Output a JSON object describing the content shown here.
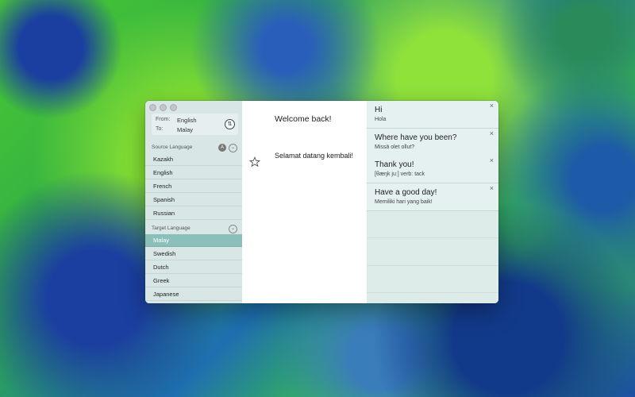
{
  "fromto": {
    "from_label": "From:",
    "from_value": "English",
    "to_label": "To:",
    "to_value": "Malay"
  },
  "source": {
    "label": "Source Language",
    "badge": "A",
    "items": [
      "Kazakh",
      "English",
      "French",
      "Spanish",
      "Russian"
    ]
  },
  "target": {
    "label": "Target Language",
    "items": [
      "Malay",
      "Swedish",
      "Dutch",
      "Greek",
      "Japanese"
    ],
    "selected": "Malay"
  },
  "main": {
    "input_text": "Welcome back!",
    "output_text": "Selamat datang kembali!"
  },
  "history": [
    {
      "primary": "Hi",
      "secondary": "Hola"
    },
    {
      "primary": "Where have you been?",
      "secondary": "Missä olet ollut?"
    },
    {
      "primary": "Thank you!",
      "secondary": "[θæŋk juː]  verb: tack"
    },
    {
      "primary": "Have a good day!",
      "secondary": "Memiliki hari yang baik!"
    }
  ],
  "icons": {
    "swap": "swap-icon",
    "star": "star-icon",
    "close": "close-icon",
    "chevron": "chevron-down-icon"
  },
  "colors": {
    "selected_row": "#8bbfb9"
  }
}
